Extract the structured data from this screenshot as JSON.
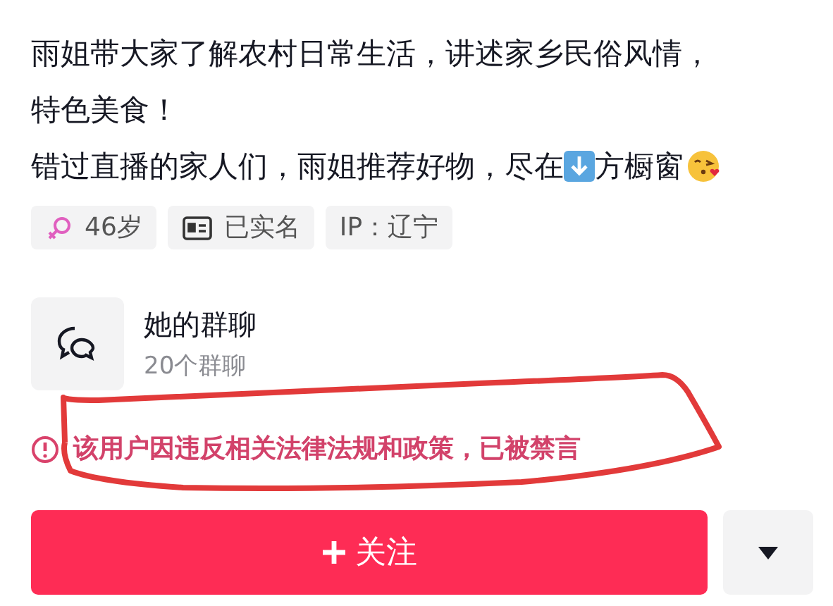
{
  "bio": {
    "line_1": "雨姐带大家了解农村日常生活，讲述家乡民俗风情，",
    "line_2": "特色美食！",
    "line_3_before": "错过直播的家人们，雨姐推荐好物，尽在",
    "line_3_after": "方橱窗"
  },
  "tags": [
    {
      "kind": "gender",
      "label": "46岁"
    },
    {
      "kind": "verified",
      "label": "已实名"
    },
    {
      "kind": "plain",
      "label": "IP：辽宁"
    }
  ],
  "group_chat": {
    "title": "她的群聊",
    "subtitle": "20个群聊"
  },
  "notice": "该用户因违反相关法律法规和政策，已被禁言",
  "follow_button": "关注"
}
